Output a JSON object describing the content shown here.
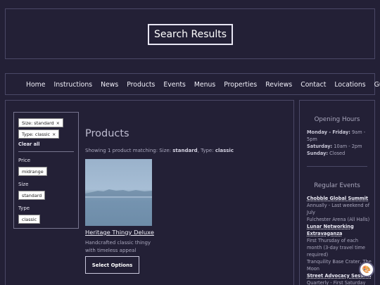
{
  "header": {
    "title": "Search Results"
  },
  "nav": {
    "items": [
      "Home",
      "Instructions",
      "News",
      "Products",
      "Events",
      "Menus",
      "Properties",
      "Reviews",
      "Contact",
      "Locations",
      "Guide"
    ]
  },
  "filters": {
    "active": [
      {
        "label": "Size: standard",
        "remove": "×"
      },
      {
        "label": "Type: classic",
        "remove": "×"
      }
    ],
    "clear_all": "Clear all",
    "price": {
      "label": "Price",
      "option": "midrange"
    },
    "size": {
      "label": "Size",
      "option": "standard"
    },
    "type": {
      "label": "Type",
      "option": "classic"
    }
  },
  "products": {
    "title": "Products",
    "showing_prefix": "Showing 1 product matching: Size: ",
    "showing_size": "standard",
    "showing_mid": ", Type: ",
    "showing_type": "classic",
    "item": {
      "name": "Heritage Thingy Deluxe",
      "description": "Handcrafted classic thingy with timeless appeal",
      "button": "Select Options"
    }
  },
  "sidebar": {
    "hours_title": "Opening Hours",
    "hours": [
      {
        "day": "Monday - Friday:",
        "time": " 9am - 5pm"
      },
      {
        "day": "Saturday:",
        "time": " 10am - 2pm"
      },
      {
        "day": "Sunday:",
        "time": " Closed"
      }
    ],
    "events_title": "Regular Events",
    "events": [
      {
        "name": "Chobble Global Summit",
        "when": "Annually - Last weekend of July",
        "where": "Fulchester Arena (All Halls)"
      },
      {
        "name": "Lunar Networking Extravaganza",
        "when": "First Thursday of each month (3-day travel time required)",
        "where": "Tranquility Base Crater, The Moon"
      },
      {
        "name": "Street Advocacy Session",
        "when": "Quarterly - First Saturday"
      }
    ]
  },
  "fab": {
    "icon": "palette-icon"
  }
}
